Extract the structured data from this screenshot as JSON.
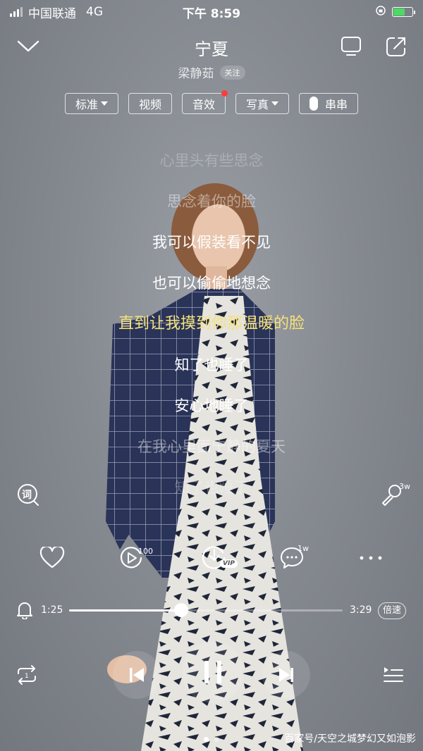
{
  "status_bar": {
    "carrier": "中国联通",
    "network": "4G",
    "time": "下午 8:59"
  },
  "header": {
    "title": "宁夏",
    "artist": "梁静茹",
    "follow": "关注",
    "icons": [
      "chevron-down-icon",
      "tv-cast-icon",
      "share-icon"
    ]
  },
  "chips": {
    "quality": "标准",
    "video": "视频",
    "effects": "音效",
    "photo": "写真",
    "chuanchuan": "串串"
  },
  "lyrics": [
    "心里头有些思念",
    "思念着你的脸",
    "我可以假装看不见",
    "也可以偷偷地想念",
    "直到让我摸到你那温暖的脸",
    "知了也睡了",
    "安心地睡了",
    "在我心里面宁静的夏天",
    "知了也睡了"
  ],
  "active_lyric_index": 4,
  "side": {
    "lyric_icon_label": "词",
    "karaoke_count": "3w"
  },
  "actions": {
    "video_count": "100",
    "download_badge": "VIP",
    "comment_count": "1w"
  },
  "progress": {
    "current": "1:25",
    "total": "3:29",
    "fraction": 0.41,
    "speed_label": "倍速"
  },
  "pager": {
    "count": 2,
    "active": 0
  },
  "watermark": "百家号/天空之城梦幻又如泡影",
  "colors": {
    "active_lyric": "#f5e27a",
    "badge_red": "#ff3b3b",
    "battery_green": "#4cd964"
  }
}
